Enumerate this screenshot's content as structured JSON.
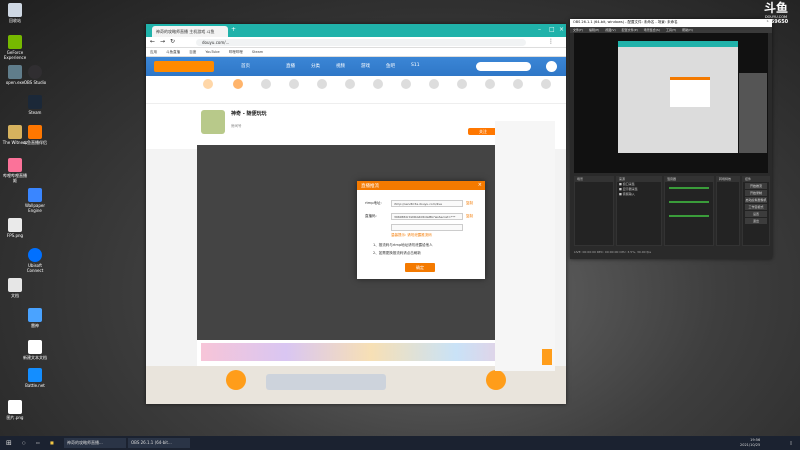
{
  "desktop_icons": [
    {
      "label": "回收站",
      "color": "#cfd8e3"
    },
    {
      "label": "GeForce Experience",
      "color": "#76b900"
    },
    {
      "label": "open.exe",
      "color": "#607d8b"
    },
    {
      "label": "OBS Studio",
      "color": "#302e31"
    },
    {
      "label": "Steam",
      "color": "#1b2838"
    },
    {
      "label": "The Witness",
      "color": "#d6b25e"
    },
    {
      "label": "哔哩哔哩直播姬",
      "color": "#fb7299"
    },
    {
      "label": "斗鱼直播伴侣",
      "color": "#ff7700"
    },
    {
      "label": "Wallpaper Engine",
      "color": "#3a86ff"
    },
    {
      "label": "Ubisoft Connect",
      "color": "#0070ff"
    },
    {
      "label": "FPS.png",
      "color": "#eaeaea"
    },
    {
      "label": "文档",
      "color": "#e6e6e6"
    },
    {
      "label": "雷神",
      "color": "#4aa3ff"
    },
    {
      "label": "新建文本文档",
      "color": "#ffffff"
    },
    {
      "label": "Battle.net",
      "color": "#148eff"
    },
    {
      "label": "图片.png",
      "color": "#ffffff"
    }
  ],
  "browser": {
    "tab_title": "神奇的攻略师直播 主机游戏 斗鱼",
    "url": "douyu.com/...",
    "bookmarks": [
      "应用",
      "斗鱼直播",
      "百度",
      "YouTube",
      "哔哩哔哩",
      "Steam"
    ],
    "site_nav": [
      "首页",
      "直播",
      "分类",
      "视频",
      "游戏",
      "鱼吧",
      "S11"
    ],
    "room_title": "神奇 - 随便玩玩",
    "room_id_label": "房间号",
    "follow_label": "关注",
    "report_label": "举报"
  },
  "dialog": {
    "title": "直播推流",
    "rtmp_label": "rtmp地址:",
    "rtmp_value": "rtmp://sendtc3a.douyu.com/live",
    "copy_label": "复制",
    "code_label": "直播码:",
    "code_value": "3969650rXxNbGKXKdaMb?wsSecret=***",
    "notice": "温馨提示: 请勿泄露推流码",
    "tip1": "1、推流码与rtmp地址请勿泄露给他人",
    "tip2": "2、如需更换推流码请点击刷新",
    "ok_label": "确定"
  },
  "obs": {
    "title": "OBS 26.1.1 (64-bit, windows) - 配置文件: 未命名 - 场景: 未命名",
    "menu": [
      "文件(F)",
      "编辑(E)",
      "视图(V)",
      "配置文件(P)",
      "场景集合(S)",
      "工具(T)",
      "帮助(H)"
    ],
    "scenes_label": "场景",
    "sources_label": "来源",
    "mixer_label": "混音器",
    "transitions_label": "转场特效",
    "controls_label": "控件",
    "buttons": [
      "开始推流",
      "开始录制",
      "启动虚拟摄像机",
      "工作室模式",
      "设置",
      "退出"
    ],
    "stats": "LIVE: 00:00:00  REC: 00:00:00  CPU: 3.5%, 30.00 fps"
  },
  "taskbar": {
    "items": [
      "神奇的攻略师直播...",
      "OBS 26.1.1 (64-bit..."
    ],
    "time": "19:56",
    "date": "2021/10/25"
  },
  "watermark": {
    "brand": "斗鱼",
    "site": "DOUYU.COM",
    "room": "3969650"
  }
}
